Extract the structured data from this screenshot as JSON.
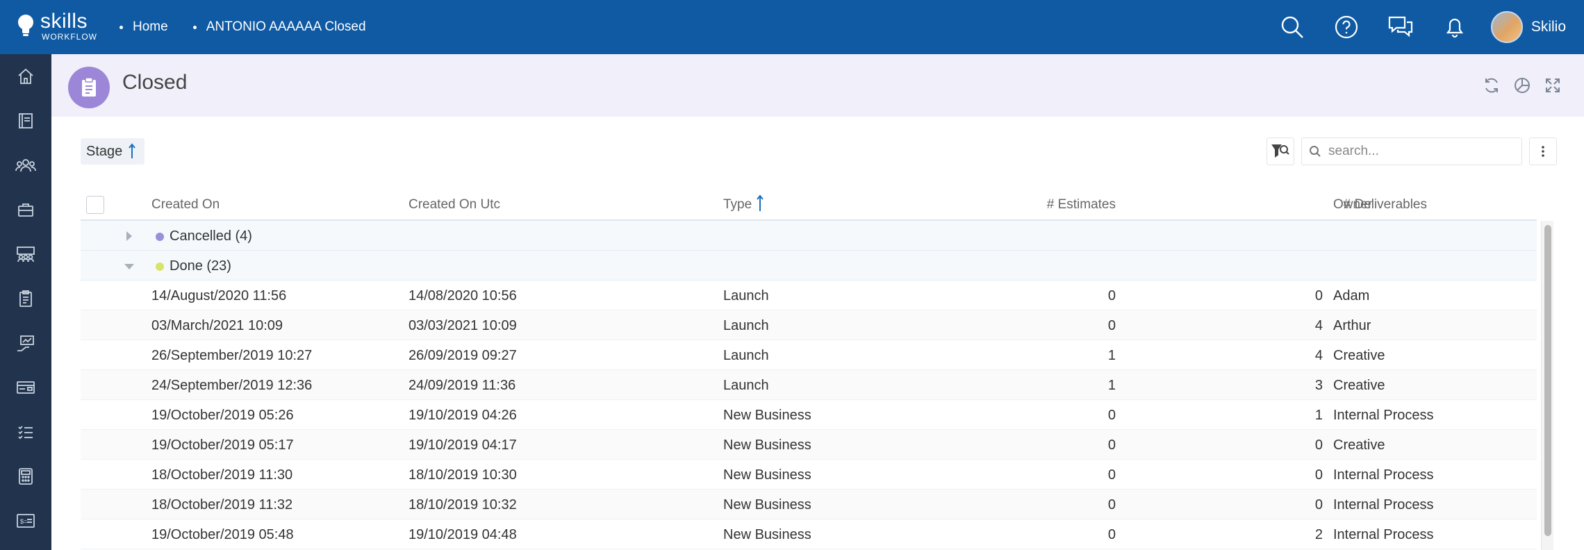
{
  "topbar": {
    "brand": "skills",
    "brand_sub": "WORKFLOW",
    "breadcrumbs": [
      "Home",
      "ANTONIO AAAAAA Closed"
    ],
    "icons": [
      "search-icon",
      "help-icon",
      "chat-icon",
      "bell-icon"
    ],
    "username": "Skilio"
  },
  "sidebar": {
    "items": [
      "home-icon",
      "book-icon",
      "people-icon",
      "briefcase-icon",
      "team-icon",
      "clipboard-icon",
      "chart-icon",
      "card-icon",
      "checklist-icon",
      "calculator-icon",
      "invoice-icon"
    ]
  },
  "page": {
    "title": "Closed",
    "actions": [
      "refresh-icon",
      "pie-chart-icon",
      "expand-icon"
    ]
  },
  "toolbar": {
    "group_label": "Stage",
    "search_placeholder": "search..."
  },
  "table": {
    "columns": {
      "created_on": "Created On",
      "created_on_utc": "Created On Utc",
      "type": "Type",
      "estimates": "# Estimates",
      "deliverables": "# Deliverables",
      "owner": "Owner"
    },
    "groups": [
      {
        "label": "Cancelled (4)",
        "color": "#9a8fd9",
        "expanded": false
      },
      {
        "label": "Done (23)",
        "color": "#d8e36b",
        "expanded": true
      }
    ],
    "rows": [
      {
        "created_on": "14/August/2020 11:56",
        "created_on_utc": "14/08/2020 10:56",
        "type": "Launch",
        "estimates": "0",
        "deliverables": "0",
        "owner": "Adam"
      },
      {
        "created_on": "03/March/2021 10:09",
        "created_on_utc": "03/03/2021 10:09",
        "type": "Launch",
        "estimates": "0",
        "deliverables": "4",
        "owner": "Arthur"
      },
      {
        "created_on": "26/September/2019 10:27",
        "created_on_utc": "26/09/2019 09:27",
        "type": "Launch",
        "estimates": "1",
        "deliverables": "4",
        "owner": "Creative"
      },
      {
        "created_on": "24/September/2019 12:36",
        "created_on_utc": "24/09/2019 11:36",
        "type": "Launch",
        "estimates": "1",
        "deliverables": "3",
        "owner": "Creative"
      },
      {
        "created_on": "19/October/2019 05:26",
        "created_on_utc": "19/10/2019 04:26",
        "type": "New Business",
        "estimates": "0",
        "deliverables": "1",
        "owner": "Internal Process"
      },
      {
        "created_on": "19/October/2019 05:17",
        "created_on_utc": "19/10/2019 04:17",
        "type": "New Business",
        "estimates": "0",
        "deliverables": "0",
        "owner": "Creative"
      },
      {
        "created_on": "18/October/2019 11:30",
        "created_on_utc": "18/10/2019 10:30",
        "type": "New Business",
        "estimates": "0",
        "deliverables": "0",
        "owner": "Internal Process"
      },
      {
        "created_on": "18/October/2019 11:32",
        "created_on_utc": "18/10/2019 10:32",
        "type": "New Business",
        "estimates": "0",
        "deliverables": "0",
        "owner": "Internal Process"
      },
      {
        "created_on": "19/October/2019 05:48",
        "created_on_utc": "19/10/2019 04:48",
        "type": "New Business",
        "estimates": "0",
        "deliverables": "2",
        "owner": "Internal Process"
      }
    ]
  },
  "colors": {
    "topbar": "#0f5aa3",
    "sidebar": "#22344d",
    "header_bg": "#f1effa",
    "badge": "#9c86d8",
    "sort_arrow": "#1a6fc2"
  }
}
